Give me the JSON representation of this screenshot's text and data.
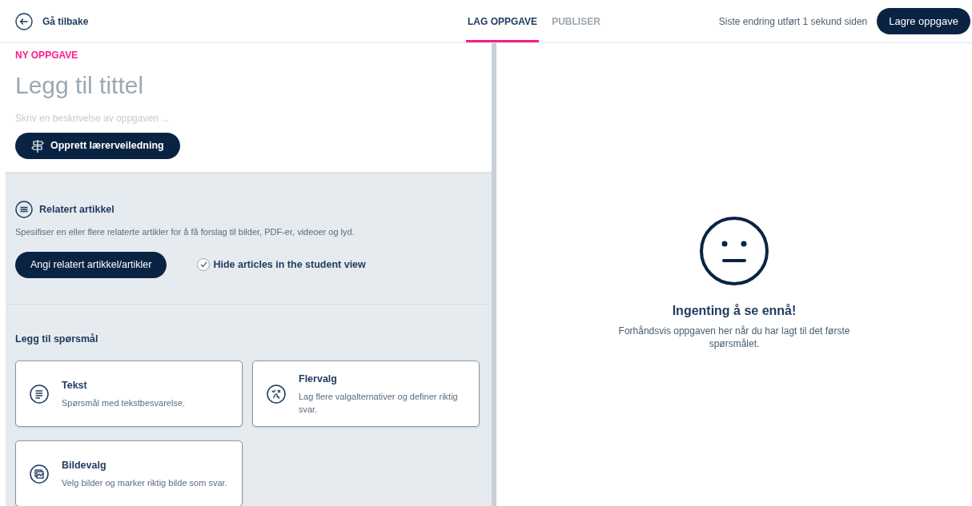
{
  "header": {
    "back": "Gå tilbake",
    "tabs": [
      {
        "label": "LAG OPPGAVE",
        "selected": true
      },
      {
        "label": "PUBLISER",
        "selected": false
      }
    ],
    "status": "Siste endring utført 1 sekund siden",
    "save": "Lagre oppgave"
  },
  "editor": {
    "eyebrow": "NY OPPGAVE",
    "title_placeholder": "Legg til tittel",
    "description_placeholder": "Skriv en beskrivelse av oppgaven ...",
    "guide_button": "Opprett lærerveiledning"
  },
  "related": {
    "title": "Relatert artikkel",
    "description": "Spesifiser en eller flere relaterte artikler for å få forslag til bilder, PDF-er, videoer og lyd.",
    "button": "Angi relatert artikkel/artikler",
    "hide_option": {
      "label": "Hide articles in the student view",
      "checked": true
    }
  },
  "questions": {
    "title": "Legg til spørsmål",
    "types": [
      {
        "kind": "text",
        "title": "Tekst",
        "description": "Spørsmål med tekstbesvarelse."
      },
      {
        "kind": "multiple",
        "title": "Flervalg",
        "description": "Lag flere valgalternativer og definer riktig svar."
      },
      {
        "kind": "image",
        "title": "Bildevalg",
        "description": "Velg bilder og marker riktig bilde som svar."
      }
    ]
  },
  "preview": {
    "title": "Ingenting å se ennå!",
    "description": "Forhåndsvis oppgaven her når du har lagt til det første spørsmålet."
  }
}
